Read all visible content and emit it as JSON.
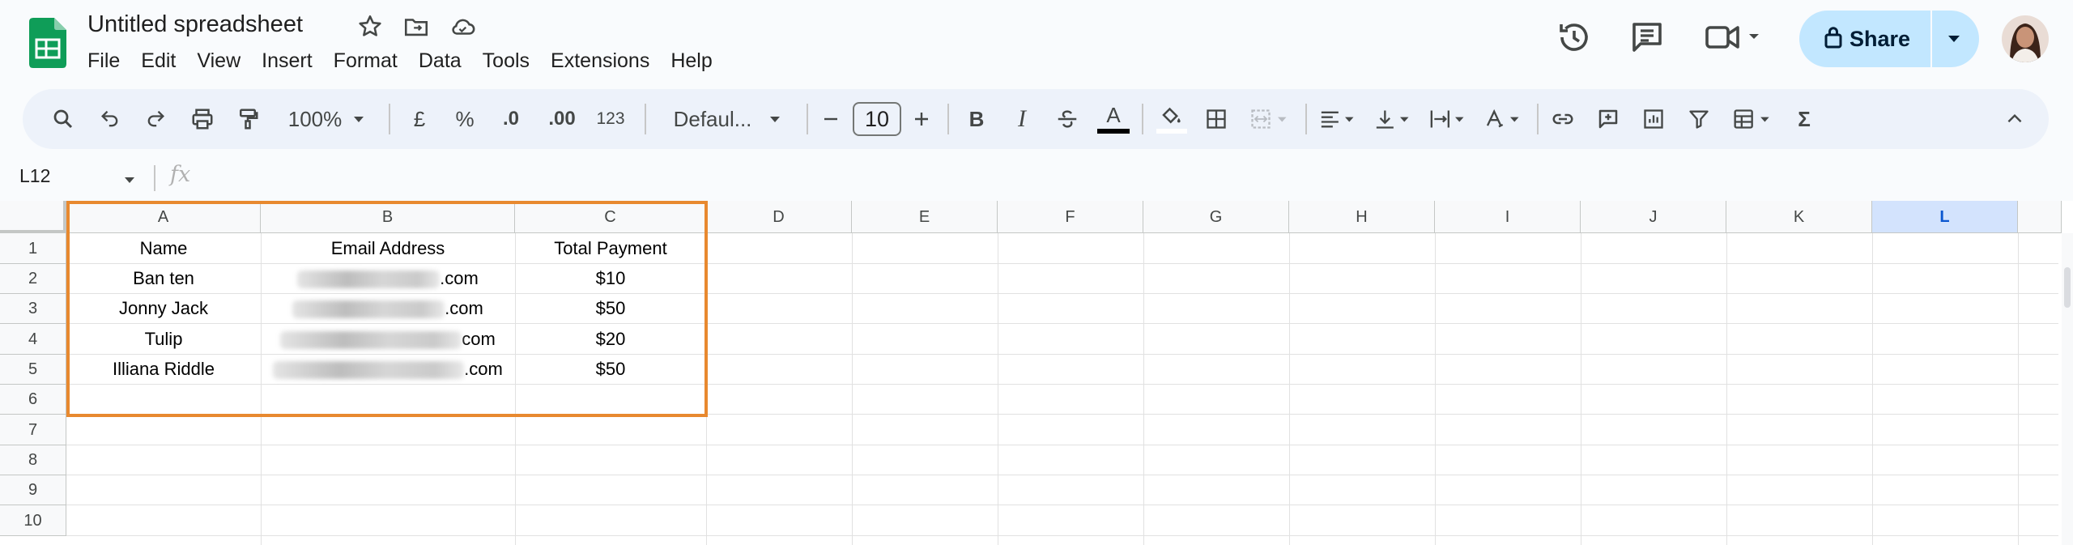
{
  "app": {
    "doc_title": "Untitled spreadsheet",
    "menu": [
      "File",
      "Edit",
      "View",
      "Insert",
      "Format",
      "Data",
      "Tools",
      "Extensions",
      "Help"
    ],
    "share_label": "Share",
    "colors": {
      "brand_green": "#0f9d58",
      "share_bg": "#c2e7ff",
      "highlight": "#e8892f",
      "selected_header": "#d3e3fd"
    }
  },
  "toolbar": {
    "zoom": "100%",
    "currency": "£",
    "percent": "%",
    "decrease_decimal": ".0",
    "increase_decimal": ".00",
    "number_format": "123",
    "font": "Defaul...",
    "font_size": "10",
    "bold": "B",
    "italic": "I",
    "text_color": "A",
    "sum": "Σ"
  },
  "formula_bar": {
    "name_box": "L12",
    "fx": "fx"
  },
  "grid": {
    "columns": [
      "A",
      "B",
      "C",
      "D",
      "E",
      "F",
      "G",
      "H",
      "I",
      "J",
      "K",
      "L"
    ],
    "selected_column": "L",
    "rows": [
      "1",
      "2",
      "3",
      "4",
      "5",
      "6",
      "7",
      "8",
      "9",
      "10"
    ],
    "table": {
      "headers": [
        "Name",
        "Email Address",
        "Total Payment"
      ],
      "rows": [
        {
          "name": "Ban ten",
          "email_suffix": ".com",
          "payment": "$10"
        },
        {
          "name": "Jonny Jack",
          "email_suffix": ".com",
          "payment": "$50"
        },
        {
          "name": "Tulip",
          "email_suffix": "com",
          "payment": "$20"
        },
        {
          "name": "Illiana Riddle",
          "email_suffix": ".com",
          "payment": "$50"
        }
      ]
    }
  }
}
